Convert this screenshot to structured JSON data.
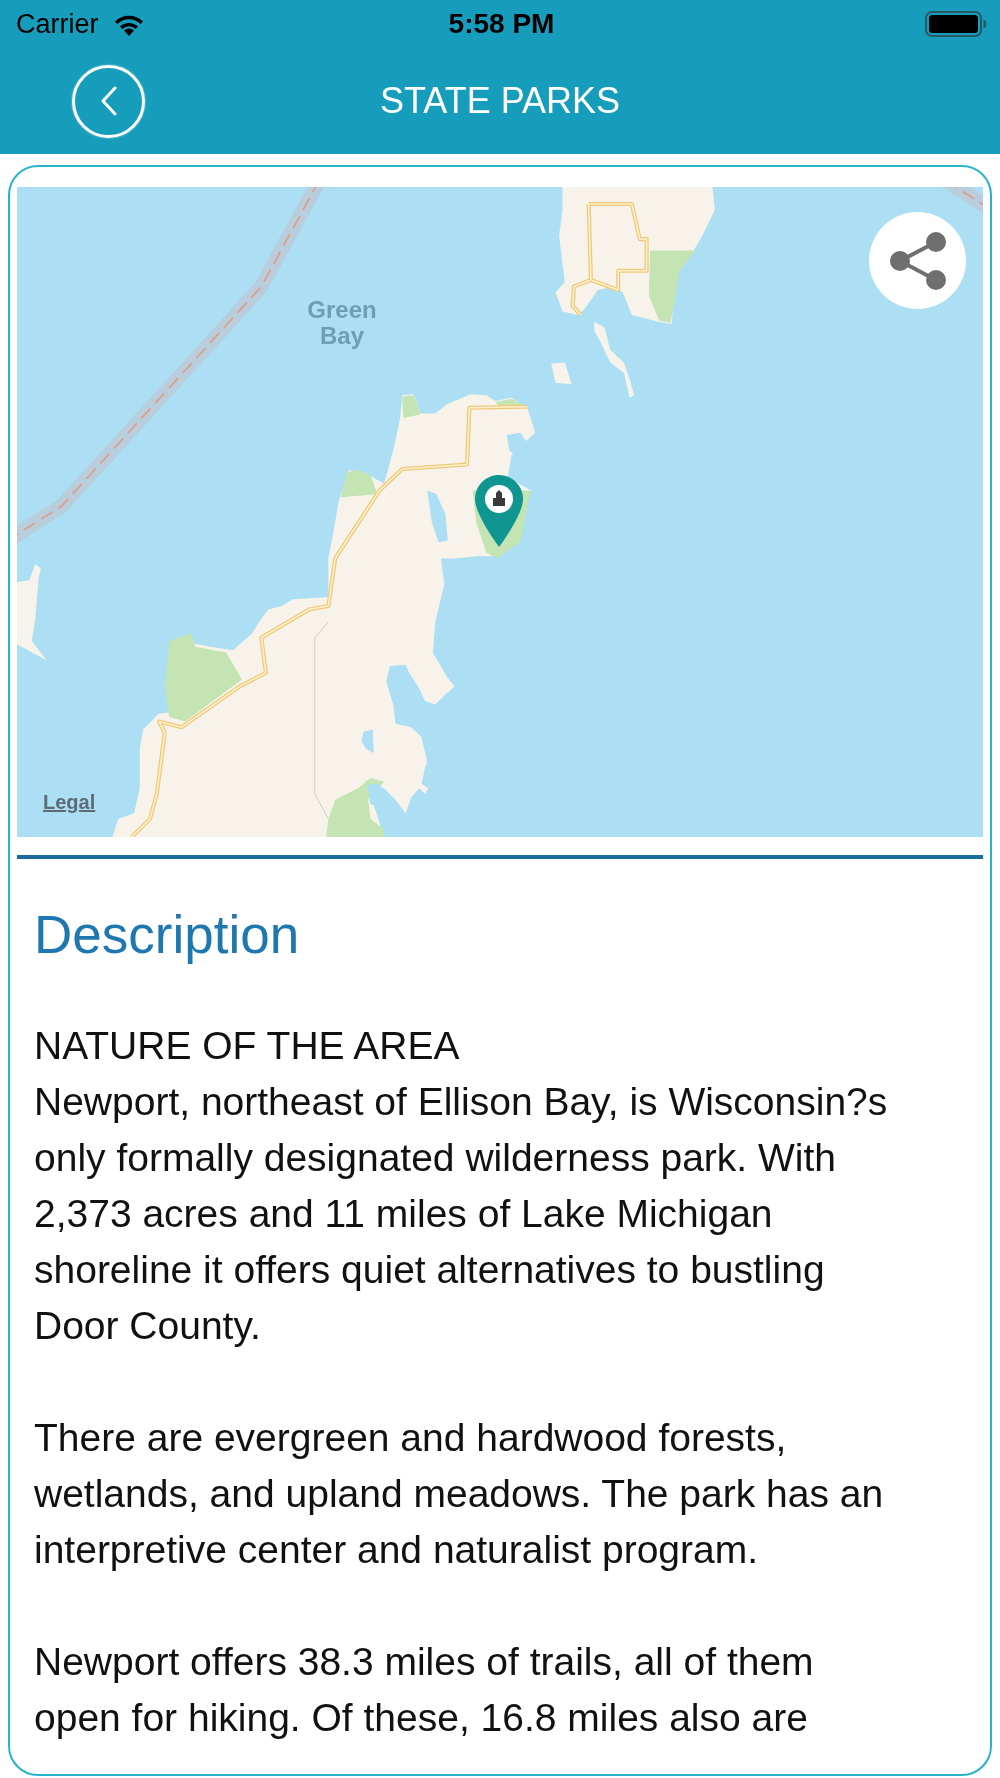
{
  "status_bar": {
    "carrier": "Carrier",
    "time": "5:58 PM"
  },
  "header": {
    "title": "STATE PARKS"
  },
  "map": {
    "label": "Green Bay",
    "legal_link": "Legal"
  },
  "description": {
    "title": "Description",
    "heading": "NATURE OF THE AREA",
    "paragraphs": [
      "Newport, northeast of Ellison Bay, is Wisconsin?s only formally designated wilderness park. With 2,373 acres and 11 miles of Lake Michigan shoreline it offers quiet alternatives to bustling Door County.",
      "There are evergreen and hardwood forests, wetlands, and upland meadows. The park has an interpretive center and naturalist program.",
      "Newport offers 38.3 miles of trails, all of them open for hiking. Of these, 16.8 miles also are"
    ]
  }
}
